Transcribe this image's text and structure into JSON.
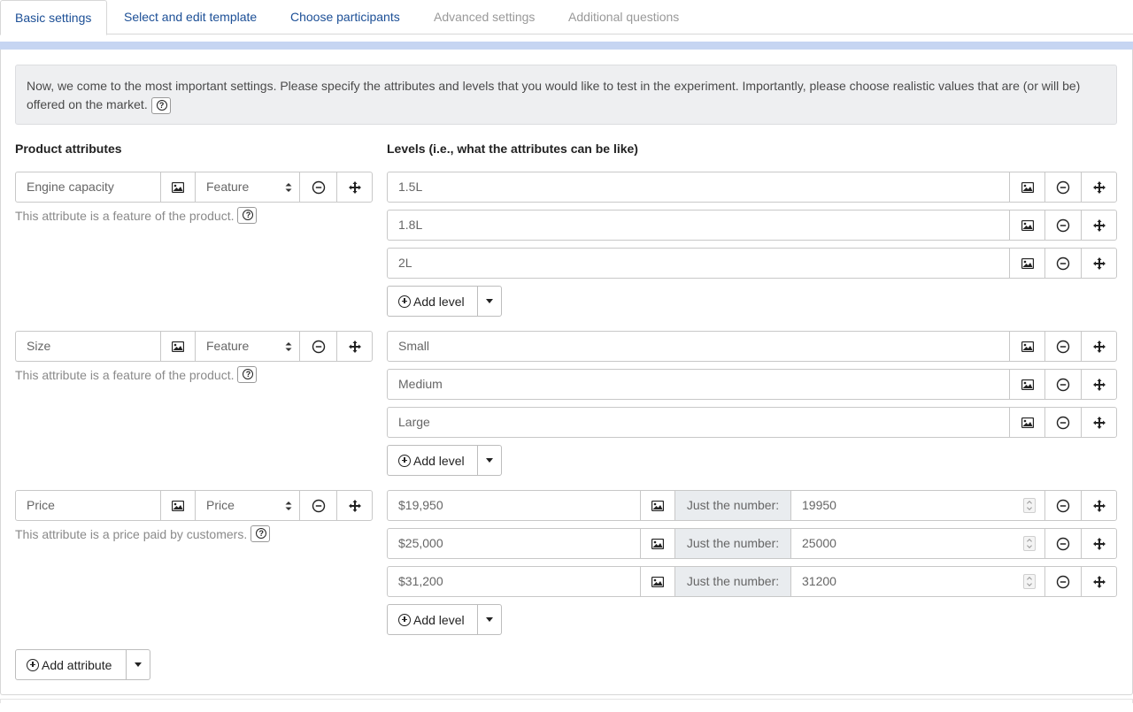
{
  "tabs": [
    {
      "label": "Basic settings",
      "state": "active"
    },
    {
      "label": "Select and edit template",
      "state": "link"
    },
    {
      "label": "Choose participants",
      "state": "link"
    },
    {
      "label": "Advanced settings",
      "state": "disabled"
    },
    {
      "label": "Additional questions",
      "state": "disabled"
    }
  ],
  "notice": {
    "text": "Now, we come to the most important settings. Please specify the attributes and levels that you would like to test in the experiment. Importantly, please choose realistic values that are (or will be) offered on the market."
  },
  "headings": {
    "attributes": "Product attributes",
    "levels": "Levels (i.e., what the attributes can be like)"
  },
  "attributes": [
    {
      "name": "Engine capacity",
      "type": "Feature",
      "hint": "This attribute is a feature of the product.",
      "levels": [
        "1.5L",
        "1.8L",
        "2L"
      ]
    },
    {
      "name": "Size",
      "type": "Feature",
      "hint": "This attribute is a feature of the product.",
      "levels": [
        "Small",
        "Medium",
        "Large"
      ]
    },
    {
      "name": "Price",
      "type": "Price",
      "hint": "This attribute is a price paid by customers.",
      "levels": [
        "$19,950",
        "$25,000",
        "$31,200"
      ],
      "number_label": "Just the number:",
      "numbers": [
        "19950",
        "25000",
        "31200"
      ]
    }
  ],
  "buttons": {
    "add_level": "Add level",
    "add_attribute": "Add attribute"
  },
  "icons": [
    "image-icon",
    "minus-circle-icon",
    "move-arrows-icon",
    "question-circle-icon",
    "plus-circle-icon",
    "caret-down-icon",
    "select-caret-icon"
  ],
  "colors": {
    "tab_link": "#1c4f96",
    "tab_disabled": "#999999",
    "band": "#c6d5f2",
    "notice_bg": "#eeeff1",
    "addon_bg": "#e9ecef"
  }
}
